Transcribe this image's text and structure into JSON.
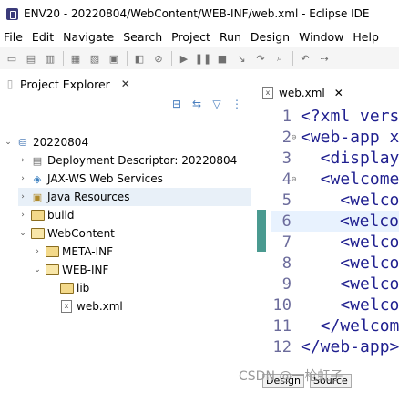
{
  "window": {
    "title": "ENV20 - 20220804/WebContent/WEB-INF/web.xml - Eclipse IDE"
  },
  "menu": [
    "File",
    "Edit",
    "Navigate",
    "Search",
    "Project",
    "Run",
    "Design",
    "Window",
    "Help"
  ],
  "toolbar": {
    "icons": [
      "new-icon",
      "save-icon",
      "save-all-icon",
      "print-icon",
      "properties-icon",
      "open-type-icon",
      "debug-icon",
      "skip-breakpoints-icon",
      "run-icon",
      "stop-icon",
      "step-icon",
      "next-icon",
      "search-icon",
      "back-icon",
      "forward-icon"
    ]
  },
  "project_explorer": {
    "tab_label": "Project Explorer",
    "close": "✕",
    "tree": [
      {
        "label": "20220804",
        "level": 0,
        "twisty": "expanded",
        "icon": "project-icon"
      },
      {
        "label": "Deployment Descriptor: 20220804",
        "level": 1,
        "twisty": "collapsed",
        "icon": "deployment-descriptor-icon"
      },
      {
        "label": "JAX-WS Web Services",
        "level": 1,
        "twisty": "collapsed",
        "icon": "web-services-icon"
      },
      {
        "label": "Java Resources",
        "level": 1,
        "twisty": "collapsed",
        "icon": "java-resources-icon",
        "selected": true
      },
      {
        "label": "build",
        "level": 1,
        "twisty": "collapsed",
        "icon": "folder-icon"
      },
      {
        "label": "WebContent",
        "level": 1,
        "twisty": "expanded",
        "icon": "folder-open-icon"
      },
      {
        "label": "META-INF",
        "level": 2,
        "twisty": "collapsed",
        "icon": "folder-icon"
      },
      {
        "label": "WEB-INF",
        "level": 2,
        "twisty": "expanded",
        "icon": "folder-open-icon"
      },
      {
        "label": "lib",
        "level": 3,
        "twisty": "none",
        "icon": "folder-icon"
      },
      {
        "label": "web.xml",
        "level": 3,
        "twisty": "none",
        "icon": "xml-file-icon"
      }
    ]
  },
  "editor": {
    "tab_label": "web.xml",
    "close": "✕",
    "lines": [
      {
        "n": "1",
        "fold": "",
        "text": "<?xml vers"
      },
      {
        "n": "2",
        "fold": "⊖",
        "text": "<web-app x"
      },
      {
        "n": "3",
        "fold": "",
        "text": "  <display"
      },
      {
        "n": "4",
        "fold": "⊖",
        "text": "  <welcome"
      },
      {
        "n": "5",
        "fold": "",
        "text": "    <welco"
      },
      {
        "n": "6",
        "fold": "",
        "text": "    <welco",
        "highlight": true
      },
      {
        "n": "7",
        "fold": "",
        "text": "    <welco"
      },
      {
        "n": "8",
        "fold": "",
        "text": "    <welco"
      },
      {
        "n": "9",
        "fold": "",
        "text": "    <welco"
      },
      {
        "n": "10",
        "fold": "",
        "text": "    <welco"
      },
      {
        "n": "11",
        "fold": "",
        "text": "  </welcom"
      },
      {
        "n": "12",
        "fold": "",
        "text": "</web-app>"
      }
    ],
    "bottom_tabs": [
      "Design",
      "Source"
    ]
  },
  "watermark": "CSDN @一枪虹子"
}
